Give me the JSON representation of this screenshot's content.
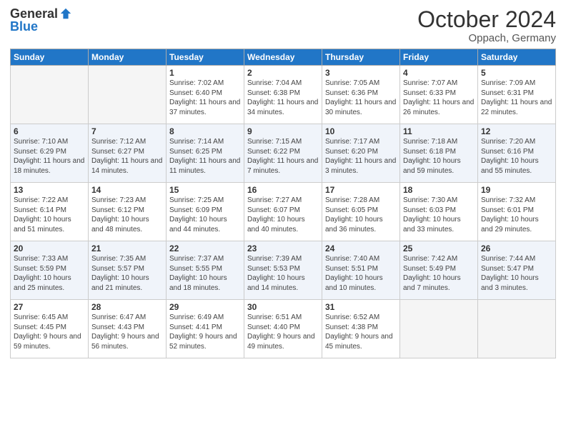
{
  "header": {
    "logo_general": "General",
    "logo_blue": "Blue",
    "month": "October 2024",
    "location": "Oppach, Germany"
  },
  "weekdays": [
    "Sunday",
    "Monday",
    "Tuesday",
    "Wednesday",
    "Thursday",
    "Friday",
    "Saturday"
  ],
  "weeks": [
    [
      {
        "day": "",
        "empty": true
      },
      {
        "day": "",
        "empty": true
      },
      {
        "day": "1",
        "sunrise": "Sunrise: 7:02 AM",
        "sunset": "Sunset: 6:40 PM",
        "daylight": "Daylight: 11 hours and 37 minutes."
      },
      {
        "day": "2",
        "sunrise": "Sunrise: 7:04 AM",
        "sunset": "Sunset: 6:38 PM",
        "daylight": "Daylight: 11 hours and 34 minutes."
      },
      {
        "day": "3",
        "sunrise": "Sunrise: 7:05 AM",
        "sunset": "Sunset: 6:36 PM",
        "daylight": "Daylight: 11 hours and 30 minutes."
      },
      {
        "day": "4",
        "sunrise": "Sunrise: 7:07 AM",
        "sunset": "Sunset: 6:33 PM",
        "daylight": "Daylight: 11 hours and 26 minutes."
      },
      {
        "day": "5",
        "sunrise": "Sunrise: 7:09 AM",
        "sunset": "Sunset: 6:31 PM",
        "daylight": "Daylight: 11 hours and 22 minutes."
      }
    ],
    [
      {
        "day": "6",
        "sunrise": "Sunrise: 7:10 AM",
        "sunset": "Sunset: 6:29 PM",
        "daylight": "Daylight: 11 hours and 18 minutes."
      },
      {
        "day": "7",
        "sunrise": "Sunrise: 7:12 AM",
        "sunset": "Sunset: 6:27 PM",
        "daylight": "Daylight: 11 hours and 14 minutes."
      },
      {
        "day": "8",
        "sunrise": "Sunrise: 7:14 AM",
        "sunset": "Sunset: 6:25 PM",
        "daylight": "Daylight: 11 hours and 11 minutes."
      },
      {
        "day": "9",
        "sunrise": "Sunrise: 7:15 AM",
        "sunset": "Sunset: 6:22 PM",
        "daylight": "Daylight: 11 hours and 7 minutes."
      },
      {
        "day": "10",
        "sunrise": "Sunrise: 7:17 AM",
        "sunset": "Sunset: 6:20 PM",
        "daylight": "Daylight: 11 hours and 3 minutes."
      },
      {
        "day": "11",
        "sunrise": "Sunrise: 7:18 AM",
        "sunset": "Sunset: 6:18 PM",
        "daylight": "Daylight: 10 hours and 59 minutes."
      },
      {
        "day": "12",
        "sunrise": "Sunrise: 7:20 AM",
        "sunset": "Sunset: 6:16 PM",
        "daylight": "Daylight: 10 hours and 55 minutes."
      }
    ],
    [
      {
        "day": "13",
        "sunrise": "Sunrise: 7:22 AM",
        "sunset": "Sunset: 6:14 PM",
        "daylight": "Daylight: 10 hours and 51 minutes."
      },
      {
        "day": "14",
        "sunrise": "Sunrise: 7:23 AM",
        "sunset": "Sunset: 6:12 PM",
        "daylight": "Daylight: 10 hours and 48 minutes."
      },
      {
        "day": "15",
        "sunrise": "Sunrise: 7:25 AM",
        "sunset": "Sunset: 6:09 PM",
        "daylight": "Daylight: 10 hours and 44 minutes."
      },
      {
        "day": "16",
        "sunrise": "Sunrise: 7:27 AM",
        "sunset": "Sunset: 6:07 PM",
        "daylight": "Daylight: 10 hours and 40 minutes."
      },
      {
        "day": "17",
        "sunrise": "Sunrise: 7:28 AM",
        "sunset": "Sunset: 6:05 PM",
        "daylight": "Daylight: 10 hours and 36 minutes."
      },
      {
        "day": "18",
        "sunrise": "Sunrise: 7:30 AM",
        "sunset": "Sunset: 6:03 PM",
        "daylight": "Daylight: 10 hours and 33 minutes."
      },
      {
        "day": "19",
        "sunrise": "Sunrise: 7:32 AM",
        "sunset": "Sunset: 6:01 PM",
        "daylight": "Daylight: 10 hours and 29 minutes."
      }
    ],
    [
      {
        "day": "20",
        "sunrise": "Sunrise: 7:33 AM",
        "sunset": "Sunset: 5:59 PM",
        "daylight": "Daylight: 10 hours and 25 minutes."
      },
      {
        "day": "21",
        "sunrise": "Sunrise: 7:35 AM",
        "sunset": "Sunset: 5:57 PM",
        "daylight": "Daylight: 10 hours and 21 minutes."
      },
      {
        "day": "22",
        "sunrise": "Sunrise: 7:37 AM",
        "sunset": "Sunset: 5:55 PM",
        "daylight": "Daylight: 10 hours and 18 minutes."
      },
      {
        "day": "23",
        "sunrise": "Sunrise: 7:39 AM",
        "sunset": "Sunset: 5:53 PM",
        "daylight": "Daylight: 10 hours and 14 minutes."
      },
      {
        "day": "24",
        "sunrise": "Sunrise: 7:40 AM",
        "sunset": "Sunset: 5:51 PM",
        "daylight": "Daylight: 10 hours and 10 minutes."
      },
      {
        "day": "25",
        "sunrise": "Sunrise: 7:42 AM",
        "sunset": "Sunset: 5:49 PM",
        "daylight": "Daylight: 10 hours and 7 minutes."
      },
      {
        "day": "26",
        "sunrise": "Sunrise: 7:44 AM",
        "sunset": "Sunset: 5:47 PM",
        "daylight": "Daylight: 10 hours and 3 minutes."
      }
    ],
    [
      {
        "day": "27",
        "sunrise": "Sunrise: 6:45 AM",
        "sunset": "Sunset: 4:45 PM",
        "daylight": "Daylight: 9 hours and 59 minutes."
      },
      {
        "day": "28",
        "sunrise": "Sunrise: 6:47 AM",
        "sunset": "Sunset: 4:43 PM",
        "daylight": "Daylight: 9 hours and 56 minutes."
      },
      {
        "day": "29",
        "sunrise": "Sunrise: 6:49 AM",
        "sunset": "Sunset: 4:41 PM",
        "daylight": "Daylight: 9 hours and 52 minutes."
      },
      {
        "day": "30",
        "sunrise": "Sunrise: 6:51 AM",
        "sunset": "Sunset: 4:40 PM",
        "daylight": "Daylight: 9 hours and 49 minutes."
      },
      {
        "day": "31",
        "sunrise": "Sunrise: 6:52 AM",
        "sunset": "Sunset: 4:38 PM",
        "daylight": "Daylight: 9 hours and 45 minutes."
      },
      {
        "day": "",
        "empty": true
      },
      {
        "day": "",
        "empty": true
      }
    ]
  ]
}
